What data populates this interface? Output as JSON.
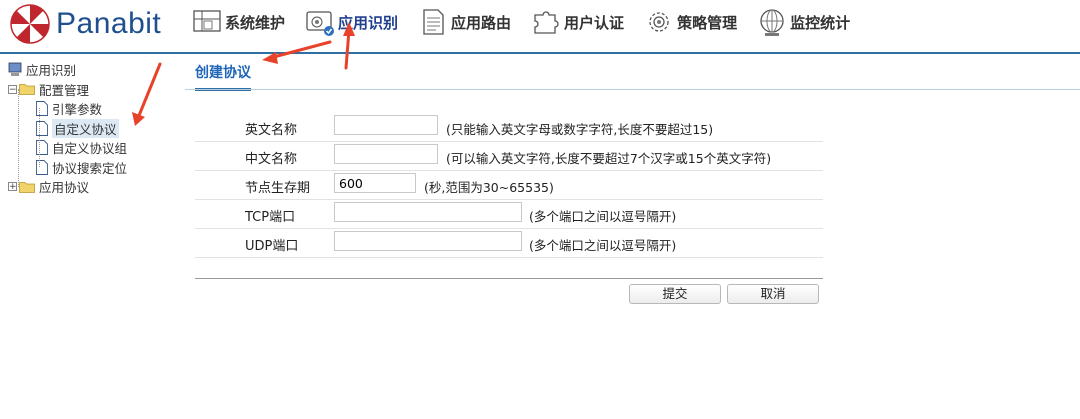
{
  "brand": {
    "name": "Panabit"
  },
  "menu": [
    {
      "label": "系统维护",
      "icon": "system-maintenance-icon"
    },
    {
      "label": "应用识别",
      "icon": "app-recognition-icon",
      "active": true
    },
    {
      "label": "应用路由",
      "icon": "app-routing-icon"
    },
    {
      "label": "用户认证",
      "icon": "user-auth-icon"
    },
    {
      "label": "策略管理",
      "icon": "policy-gear-icon"
    },
    {
      "label": "监控统计",
      "icon": "monitor-stats-icon"
    }
  ],
  "tree": {
    "root": "应用识别",
    "config": "配置管理",
    "engine_params": "引擎参数",
    "custom_protocol": "自定义协议",
    "custom_protocol_group": "自定义协议组",
    "protocol_search": "协议搜索定位",
    "app_protocols": "应用协议"
  },
  "page": {
    "tab_title": "创建协议"
  },
  "form": {
    "english_name": {
      "label": "英文名称",
      "value": "",
      "hint": "(只能输入英文字母或数字字符,长度不要超过15)"
    },
    "chinese_name": {
      "label": "中文名称",
      "value": "",
      "hint": "(可以输入英文字符,长度不要超过7个汉字或15个英文字符)"
    },
    "node_ttl": {
      "label": "节点生存期",
      "value": "600",
      "hint": "(秒,范围为30~65535)"
    },
    "tcp_port": {
      "label": "TCP端口",
      "value": "",
      "hint": "(多个端口之间以逗号隔开)"
    },
    "udp_port": {
      "label": "UDP端口",
      "value": "",
      "hint": "(多个端口之间以逗号隔开)"
    }
  },
  "buttons": {
    "submit": "提交",
    "cancel": "取消"
  },
  "colors": {
    "accent": "#2f6fa3",
    "brand": "#1f4f8f",
    "arrow": "#e8422a"
  }
}
